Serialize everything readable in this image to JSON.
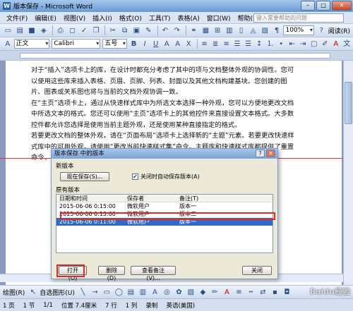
{
  "window": {
    "title": "版本保存 - Microsoft Word",
    "app_icon": "W"
  },
  "menu": {
    "items": [
      "文件(F)",
      "编辑(E)",
      "视图(V)",
      "插入(I)",
      "格式(O)",
      "工具(T)",
      "表格(A)",
      "窗口(W)",
      "帮助(H)"
    ],
    "help_placeholder": "键入需要帮助的问题"
  },
  "toolbar1": {
    "zoom": "100%",
    "read_label": "阅读(R)"
  },
  "toolbar2": {
    "style": "正文",
    "font": "Calibri",
    "size": "五号"
  },
  "document": {
    "paragraphs": [
      "对于“插入”选项卡上的库，在设计时都充分考虑了其中的项与文档整体外观的协调性。您可以使用这些库来插入表格、页眉、页脚、列表、封面以及其他文档构建基块。您创建的图片、图表或关系图也将与当前的文档外观协调一致。",
      "在“主页”选项卡上，通过从快速样式库中为所选文本选择一种外观，您可以方便地更改文档中所选文本的格式。您还可以使用“主页”选项卡上的其他控件来直接设置文本格式。大多数控件都允许您选择是使用当前主题外观，还是使用某种直接指定的格式。",
      "若要更改文档的整体外观，请在“页面布局”选项卡上选择新的“主题”元素。若要更改快速样式库中的可用外观，请使用“更改当前快速样式集”命令。主题库和快速样式库都提供了重置命令，因而您总是能够将文档外观还原为当前模板所包含的原始外观。"
    ]
  },
  "dialog": {
    "title": "版本保存 中的版本",
    "new_section": "新版本",
    "save_now_button": "现在保存(S)...",
    "auto_save_checkbox": "关闭时自动保存版本(A)",
    "auto_save_checked": true,
    "existing_section": "原有版本",
    "columns": [
      "日期和时间",
      "保存者",
      "备注(T)"
    ],
    "rows": [
      {
        "date": "2015-06-06 0:15:00",
        "user": "微软用户",
        "note": "版本一"
      },
      {
        "date": "2015-06-06 0:13:00",
        "user": "微软用户",
        "note": "版本二"
      },
      {
        "date": "2015-06-06 0:11:00",
        "user": "微软用户",
        "note": "版本一"
      }
    ],
    "selected_row": 2,
    "open_button": "打开(O)",
    "delete_button": "删除(D)",
    "view_notes_button": "查看备注(V)...",
    "close_button": "关闭"
  },
  "drawbar": {
    "draw_label": "绘图(R)",
    "autoshape_label": "自选图形(U)"
  },
  "status": {
    "page": "1 页",
    "section": "1 节",
    "pages": "1/1",
    "position": "位置 7.4厘米",
    "line": "7 行",
    "col": "1 列",
    "rec": "录制",
    "lang": "英语(美国)"
  },
  "watermark": "Baidu经验"
}
